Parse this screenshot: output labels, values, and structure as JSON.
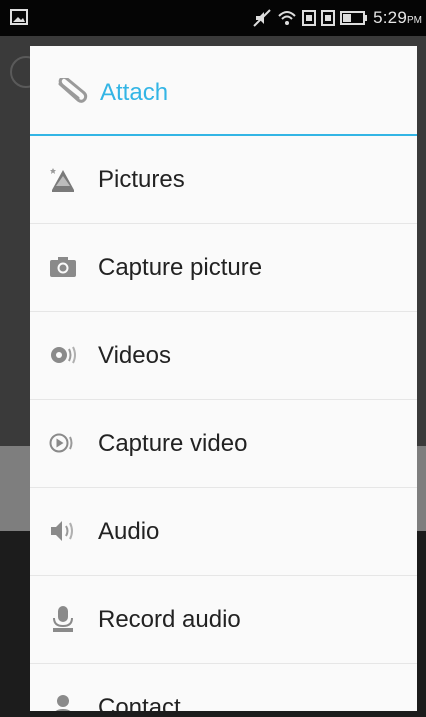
{
  "status_bar": {
    "time": "5:29",
    "ampm": "PM"
  },
  "dialog": {
    "title": "Attach",
    "items": [
      {
        "label": "Pictures",
        "icon": "pictures-icon"
      },
      {
        "label": "Capture picture",
        "icon": "camera-icon"
      },
      {
        "label": "Videos",
        "icon": "videos-icon"
      },
      {
        "label": "Capture video",
        "icon": "capture-video-icon"
      },
      {
        "label": "Audio",
        "icon": "audio-icon"
      },
      {
        "label": "Record audio",
        "icon": "microphone-icon"
      },
      {
        "label": "Contact",
        "icon": "contact-icon"
      }
    ]
  },
  "colors": {
    "accent": "#33b5e5",
    "dialog_bg": "#fafafa",
    "text": "#222222"
  }
}
